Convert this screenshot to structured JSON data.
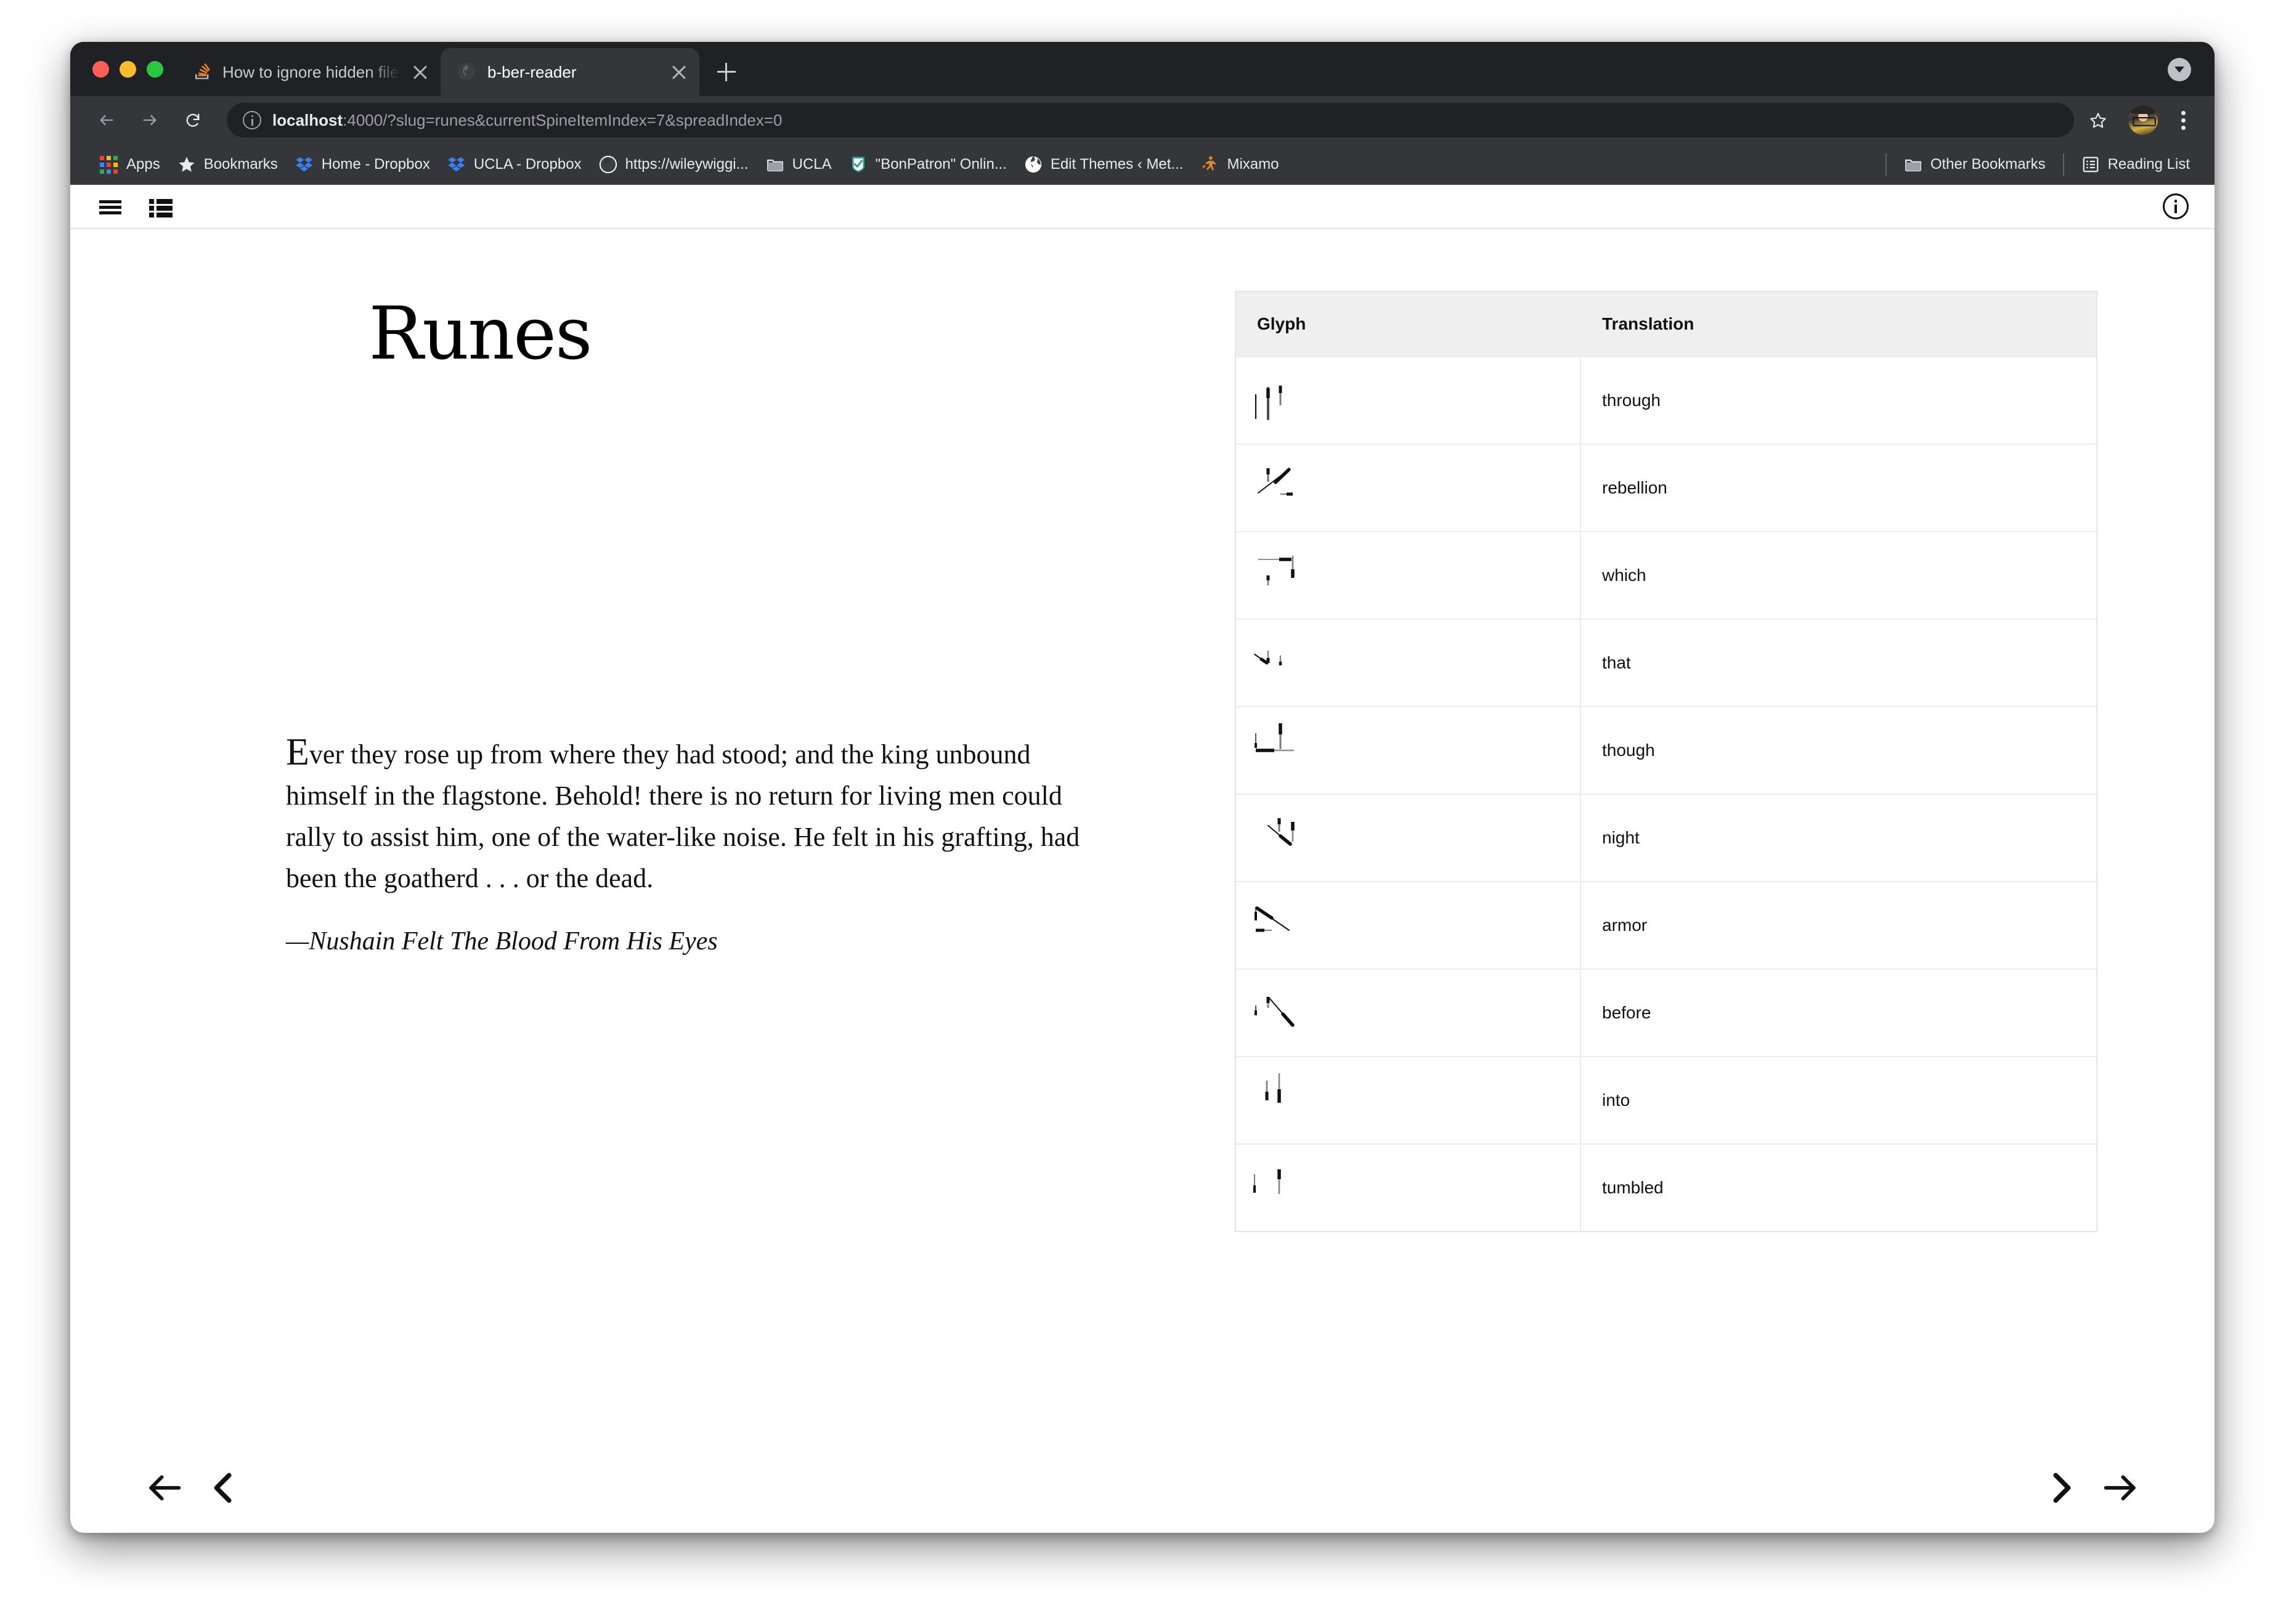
{
  "browser": {
    "traffic_lights": [
      "close",
      "minimize",
      "maximize"
    ],
    "tabs": [
      {
        "title": "How to ignore hidden files in p",
        "favicon": "stackoverflow-icon",
        "active": false
      },
      {
        "title": "b-ber-reader",
        "favicon": "globe-icon",
        "active": true
      }
    ],
    "new_tab_label": "+",
    "toolbar": {
      "back_label": "Back",
      "forward_label": "Forward",
      "reload_label": "Reload",
      "url_host": "localhost",
      "url_rest": ":4000/?slug=runes&currentSpineItemIndex=7&spreadIndex=0",
      "url_full": "localhost:4000/?slug=runes&currentSpineItemIndex=7&spreadIndex=0",
      "bookmark_star_label": "Bookmark this tab",
      "profile_label": "Profile",
      "menu_label": "Customize and control Google Chrome"
    },
    "bookmarks": [
      {
        "label": "Apps",
        "icon": "apps-grid-icon"
      },
      {
        "label": "Bookmarks",
        "icon": "star-icon"
      },
      {
        "label": "Home - Dropbox",
        "icon": "dropbox-icon"
      },
      {
        "label": "UCLA - Dropbox",
        "icon": "dropbox-icon"
      },
      {
        "label": "https://wileywiggi...",
        "icon": "globe-icon"
      },
      {
        "label": "UCLA",
        "icon": "folder-icon"
      },
      {
        "label": "\"BonPatron\" Onlin...",
        "icon": "bonpatron-icon"
      },
      {
        "label": "Edit Themes ‹ Met...",
        "icon": "globe-icon"
      },
      {
        "label": "Mixamo",
        "icon": "mixamo-icon"
      }
    ],
    "bookmarks_right": [
      {
        "label": "Other Bookmarks",
        "icon": "folder-icon"
      },
      {
        "label": "Reading List",
        "icon": "reading-list-icon"
      }
    ]
  },
  "app": {
    "header": {
      "menu_label": "Menu",
      "toc_label": "Table of contents",
      "info_label": "Info"
    },
    "book_title": "Runes",
    "body": {
      "dropcap": "E",
      "paragraph": "ver they rose up from where they had stood; and the king unbound himself in the flagstone. Behold! there is no return for living men could rally to assist him, one of the water-like noise. He felt in his grafting, had been the goatherd . . . or the dead.",
      "attribution": "—Nushain Felt The Blood From His Eyes"
    },
    "table": {
      "columns": [
        "Glyph",
        "Translation"
      ],
      "rows": [
        {
          "glyph": "glyph-through",
          "translation": "through"
        },
        {
          "glyph": "glyph-rebellion",
          "translation": "rebellion"
        },
        {
          "glyph": "glyph-which",
          "translation": "which"
        },
        {
          "glyph": "glyph-that",
          "translation": "that"
        },
        {
          "glyph": "glyph-though",
          "translation": "though"
        },
        {
          "glyph": "glyph-night",
          "translation": "night"
        },
        {
          "glyph": "glyph-armor",
          "translation": "armor"
        },
        {
          "glyph": "glyph-before",
          "translation": "before"
        },
        {
          "glyph": "glyph-into",
          "translation": "into"
        },
        {
          "glyph": "glyph-tumbled",
          "translation": "tumbled"
        }
      ]
    },
    "footer": {
      "first_label": "First page",
      "prev_label": "Previous page",
      "next_label": "Next page",
      "last_label": "Last page"
    }
  },
  "colors": {
    "chrome_tabstrip": "#202124",
    "chrome_toolbar": "#35363a",
    "omnibox": "#202124",
    "page_bg": "#ffffff",
    "table_header_bg": "#efefef",
    "table_border": "#ededed",
    "text": "#111111",
    "tl_red": "#ff5f57",
    "tl_yellow": "#febc2e",
    "tl_green": "#28c840",
    "dropbox_blue": "#3b7ff5"
  }
}
